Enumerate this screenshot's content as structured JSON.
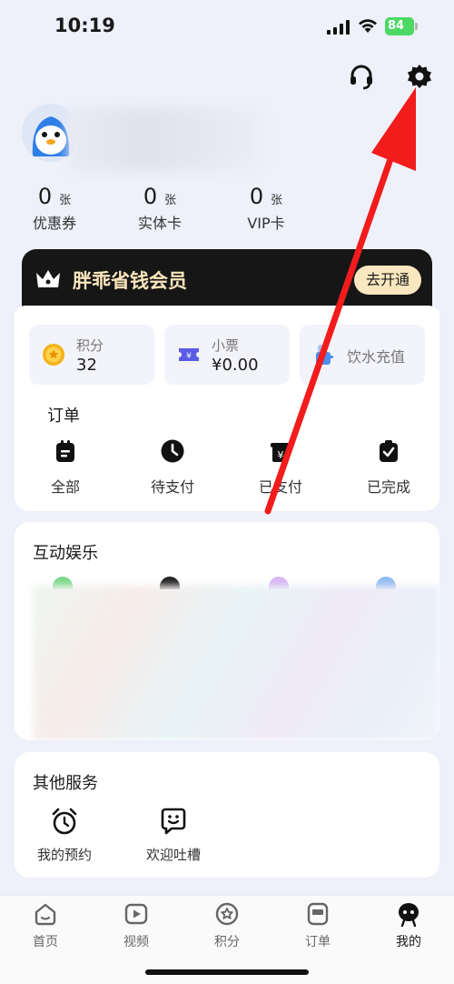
{
  "status_bar": {
    "time": "10:19",
    "battery": "84"
  },
  "stats": [
    {
      "num": "0",
      "unit": "张",
      "label": "优惠券"
    },
    {
      "num": "0",
      "unit": "张",
      "label": "实体卡"
    },
    {
      "num": "0",
      "unit": "张",
      "label": "VIP卡"
    }
  ],
  "member": {
    "title": "胖乖省钱会员",
    "button": "去开通"
  },
  "tiles": {
    "points": {
      "label": "积分",
      "value": "32"
    },
    "ticket": {
      "label": "小票",
      "value": "¥0.00"
    },
    "water": {
      "label": "饮水充值"
    }
  },
  "orders": {
    "title": "订单",
    "items": [
      "全部",
      "待支付",
      "已支付",
      "已完成"
    ]
  },
  "entertainment": {
    "title": "互动娱乐"
  },
  "services": {
    "title": "其他服务",
    "items": [
      "我的预约",
      "欢迎吐槽"
    ]
  },
  "nav": [
    "首页",
    "视频",
    "积分",
    "订单",
    "我的"
  ],
  "colors": {
    "member_bg": "#161616",
    "member_gold": "#fce6bd",
    "arrow": "#f21c1c",
    "battery": "#4cd964"
  }
}
